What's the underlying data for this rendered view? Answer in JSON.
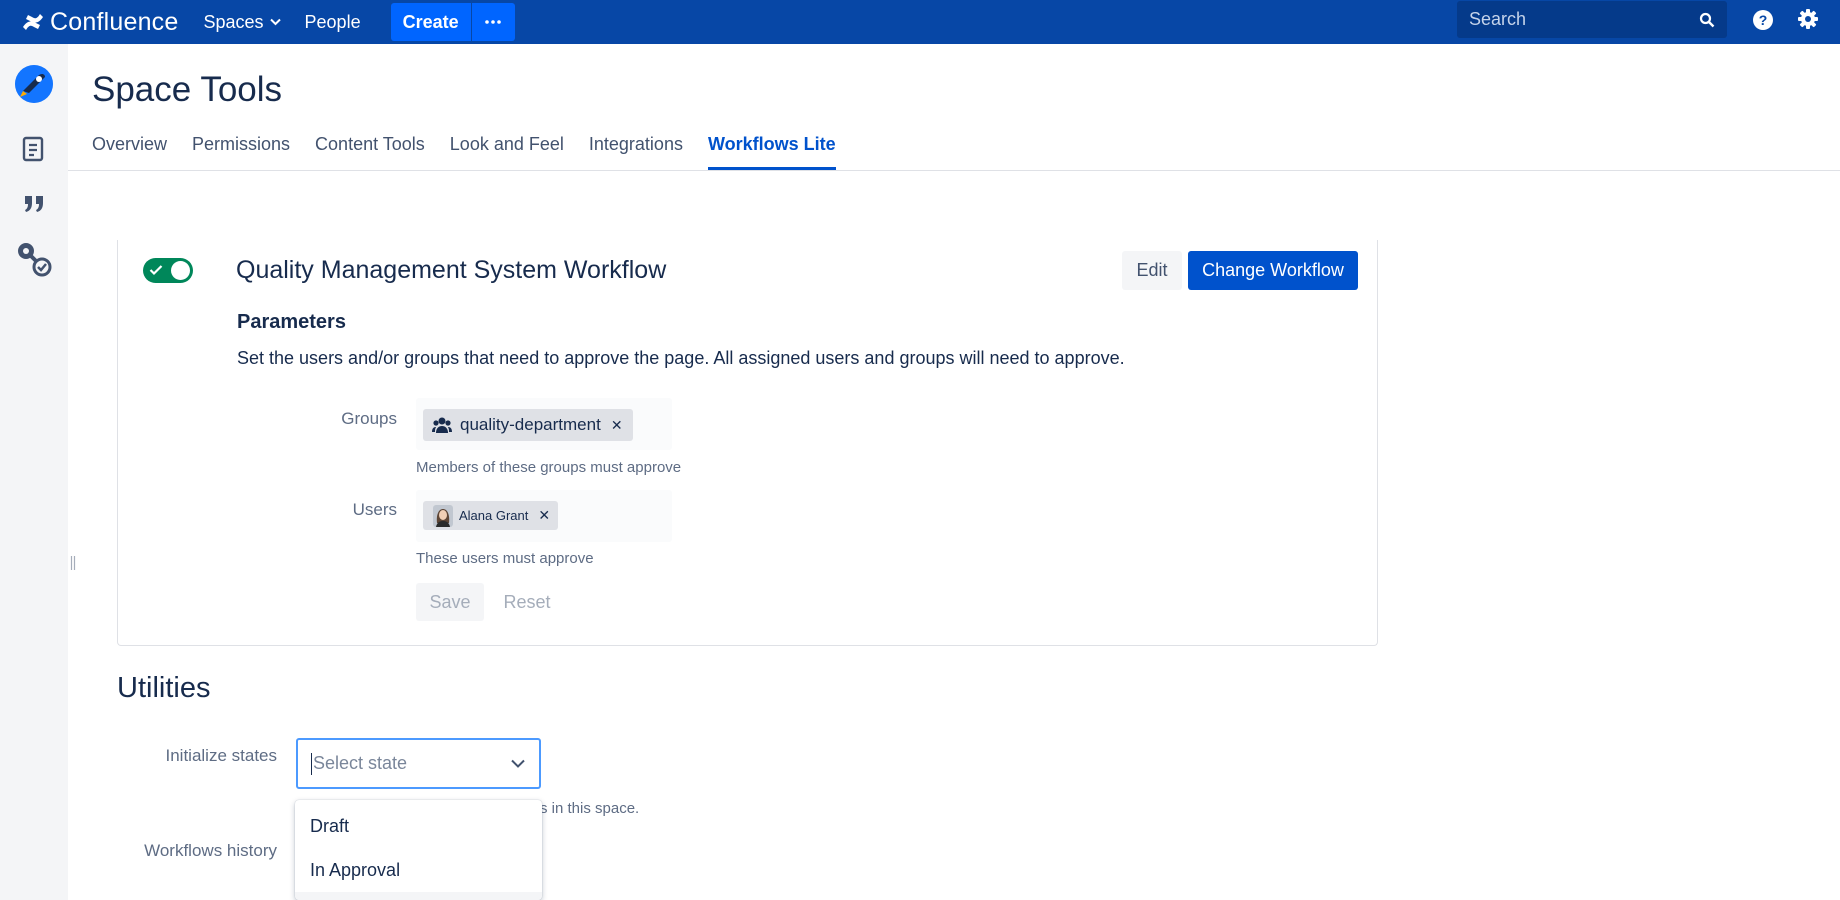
{
  "topnav": {
    "brand": "Confluence",
    "spaces_label": "Spaces",
    "people_label": "People",
    "create_label": "Create",
    "more_label": "···",
    "search_placeholder": "Search",
    "bar_color": "#0747a6",
    "button_color": "#0065ff"
  },
  "sidebar": {
    "icons": [
      "space-avatar-icon",
      "pages-icon",
      "blog-quote-icon",
      "space-tools-icon"
    ]
  },
  "header": {
    "title": "Space Tools",
    "tabs": [
      {
        "label": "Overview",
        "active": false
      },
      {
        "label": "Permissions",
        "active": false
      },
      {
        "label": "Content Tools",
        "active": false
      },
      {
        "label": "Look and Feel",
        "active": false
      },
      {
        "label": "Integrations",
        "active": false
      },
      {
        "label": "Workflows Lite",
        "active": true
      }
    ]
  },
  "workflow": {
    "enabled": true,
    "title": "Quality Management System Workflow",
    "edit_label": "Edit",
    "change_label": "Change Workflow",
    "parameters_heading": "Parameters",
    "parameters_desc": "Set the users and/or groups that need to approve the page. All assigned users and groups will need to approve.",
    "groups_label": "Groups",
    "groups": [
      "quality-department"
    ],
    "groups_helper": "Members of these groups must approve",
    "users_label": "Users",
    "users": [
      "Alana Grant"
    ],
    "users_helper": "These users must approve",
    "save_label": "Save",
    "reset_label": "Reset"
  },
  "utilities": {
    "heading": "Utilities",
    "init_states_label": "Initialize states",
    "select_placeholder": "Select state",
    "init_helper_visible": "s in this space.",
    "history_label": "Workflows history",
    "options": [
      "Draft",
      "In Approval"
    ]
  }
}
